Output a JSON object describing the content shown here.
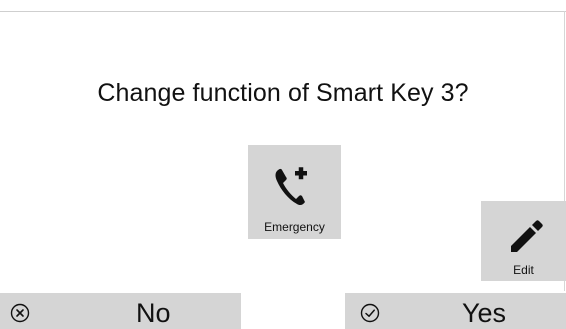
{
  "dialog": {
    "question": "Change function of Smart Key 3?"
  },
  "options": {
    "emergency": {
      "label": "Emergency",
      "icon": "phone-plus-icon"
    },
    "edit": {
      "label": "Edit",
      "icon": "pencil-icon"
    }
  },
  "actions": {
    "no": {
      "label": "No",
      "icon": "circle-x-icon"
    },
    "yes": {
      "label": "Yes",
      "icon": "circle-check-icon"
    }
  },
  "colors": {
    "background": "#ffffff",
    "tile": "#d5d5d5",
    "text": "#111111"
  }
}
